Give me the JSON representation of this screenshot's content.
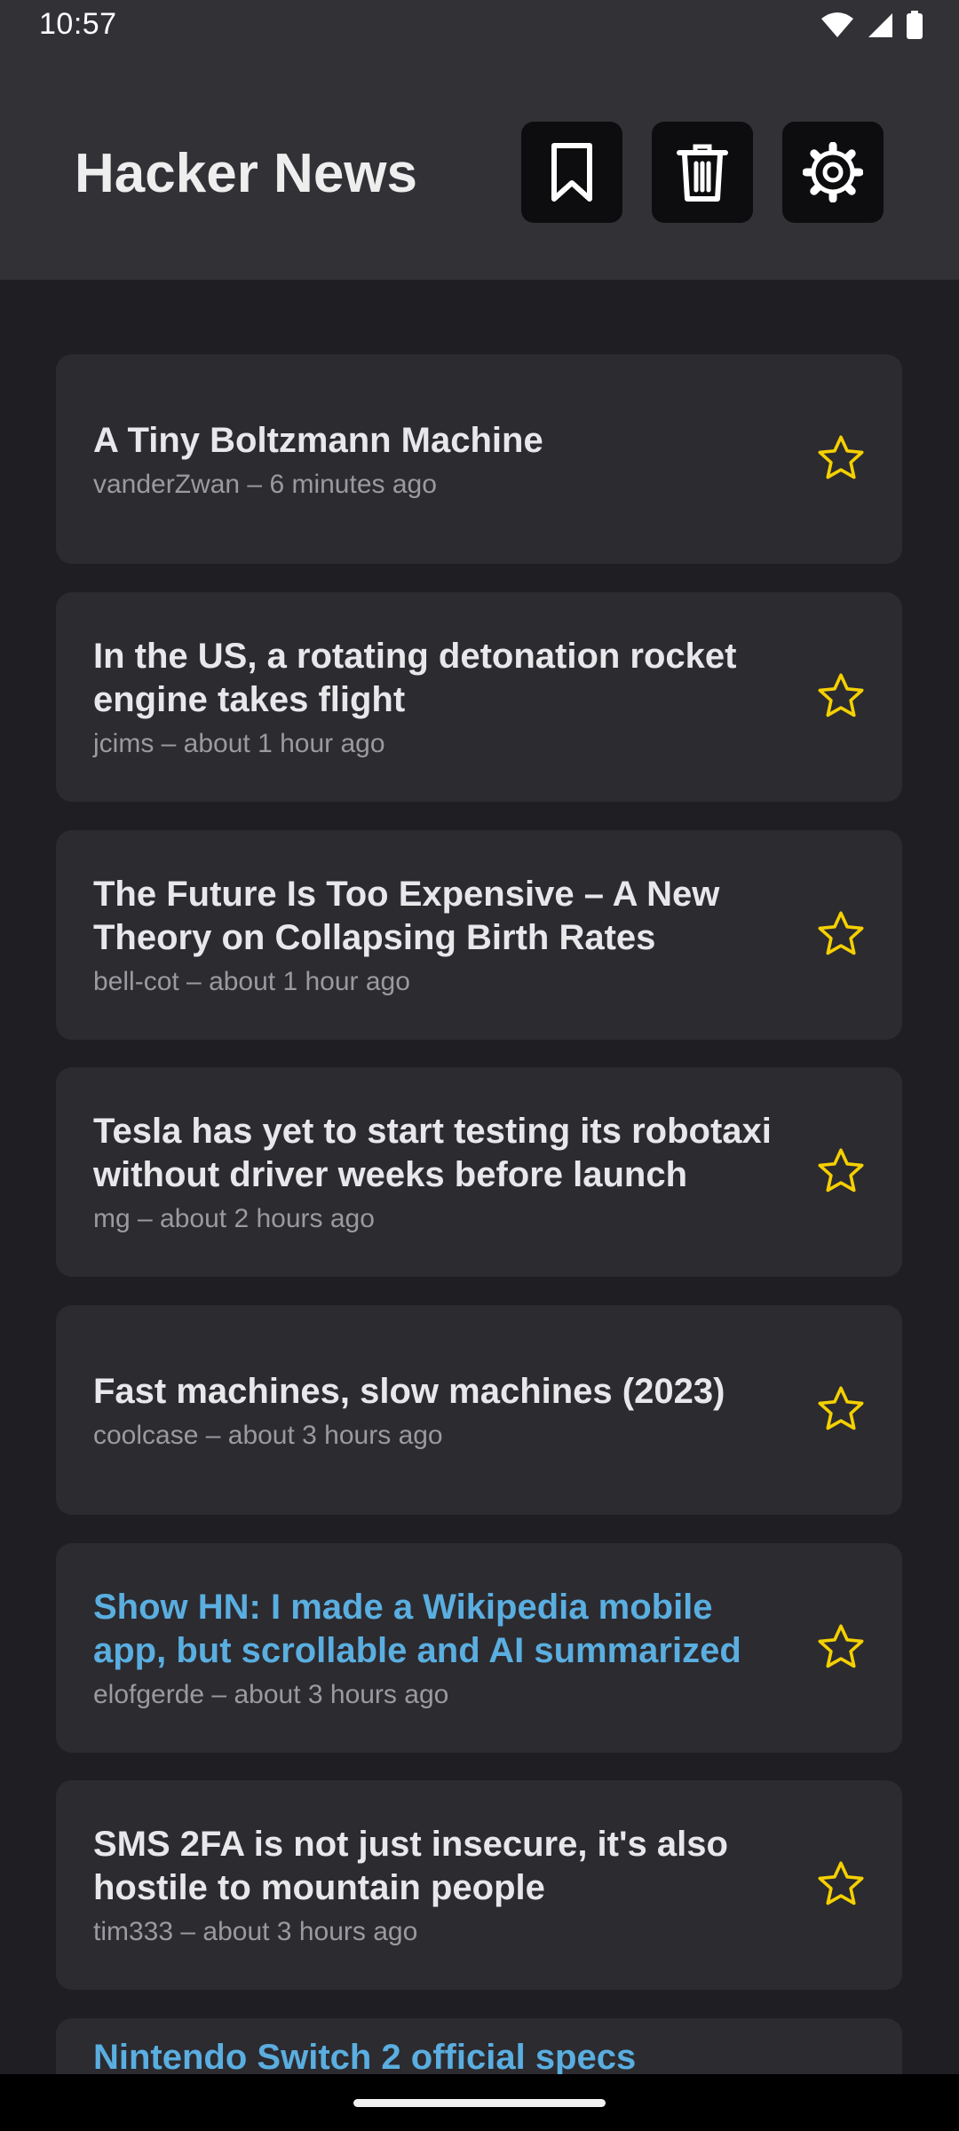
{
  "status": {
    "time": "10:57"
  },
  "app": {
    "title": "Hacker News"
  },
  "toolbar": {
    "bookmark_icon": "bookmark-icon",
    "delete_icon": "trash-icon",
    "settings_icon": "gear-icon"
  },
  "colors": {
    "background": "#1f1e23",
    "appbar": "#323136",
    "card": "#2c2b30",
    "star": "#f5d000",
    "visited": "#5aaee0"
  },
  "stories": [
    {
      "title": "A Tiny Boltzmann Machine",
      "meta": "vanderZwan – 6 minutes ago"
    },
    {
      "title": "In the US, a rotating detonation rocket engine takes flight",
      "meta": "jcims – about 1 hour ago"
    },
    {
      "title": "The Future Is Too Expensive – A New Theory on Collapsing Birth Rates",
      "meta": "bell-cot – about 1 hour ago"
    },
    {
      "title": "Tesla has yet to start testing its robotaxi without driver weeks before launch",
      "meta": "mg – about 2 hours ago"
    },
    {
      "title": "Fast machines, slow machines (2023)",
      "meta": "coolcase – about 3 hours ago"
    },
    {
      "title": "Show HN: I made a Wikipedia mobile app, but scrollable and AI summarized",
      "meta": "elofgerde – about 3 hours ago"
    },
    {
      "title": "SMS 2FA is not just insecure, it's also hostile to mountain people",
      "meta": "tim333 – about 3 hours ago"
    },
    {
      "title": "Nintendo Switch 2 official specs",
      "meta": ""
    }
  ]
}
